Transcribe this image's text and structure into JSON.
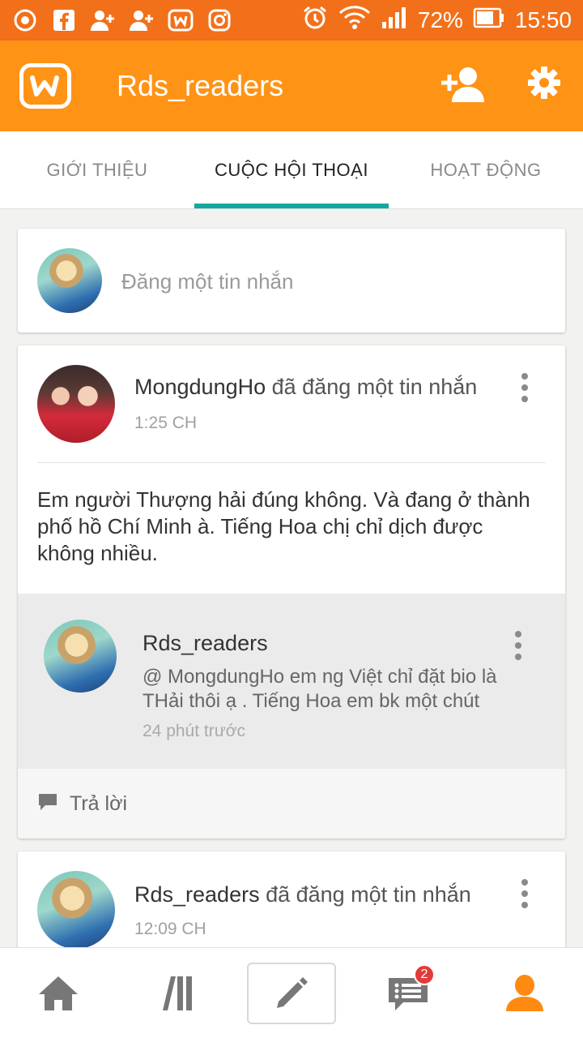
{
  "status_bar": {
    "battery": "72%",
    "time": "15:50"
  },
  "app_bar": {
    "title": "Rds_readers"
  },
  "tabs": [
    {
      "label": "GIỚI THIỆU",
      "active": false
    },
    {
      "label": "CUỘC HỘI THOẠI",
      "active": true
    },
    {
      "label": "HOẠT ĐỘNG",
      "active": false
    }
  ],
  "compose": {
    "placeholder": "Đăng một tin nhắn"
  },
  "post1": {
    "author": "MongdungHo",
    "action": " đã đăng một tin nhắn",
    "time": "1:25 CH",
    "body": "Em người Thượng hải đúng không. Và đang ở thành phố hồ Chí Minh à. Tiếng Hoa chị chỉ dịch được không nhiều.",
    "reply": {
      "author": "Rds_readers",
      "text": "@ MongdungHo  em ng Việt chỉ đặt bio là THải thôi ạ . Tiếng Hoa em bk một chút",
      "time": "24 phút trước"
    },
    "reply_label": "Trả lời"
  },
  "post2": {
    "author": "Rds_readers",
    "action": " đã đăng một tin nhắn",
    "time": "12:09 CH"
  },
  "bottom_nav": {
    "messages_badge": "2"
  },
  "colors": {
    "status_bar": "#f2701a",
    "app_bar": "#ff9316",
    "tab_indicator": "#13a89e",
    "accent_profile": "#ff8a12",
    "badge": "#e23b3b"
  }
}
